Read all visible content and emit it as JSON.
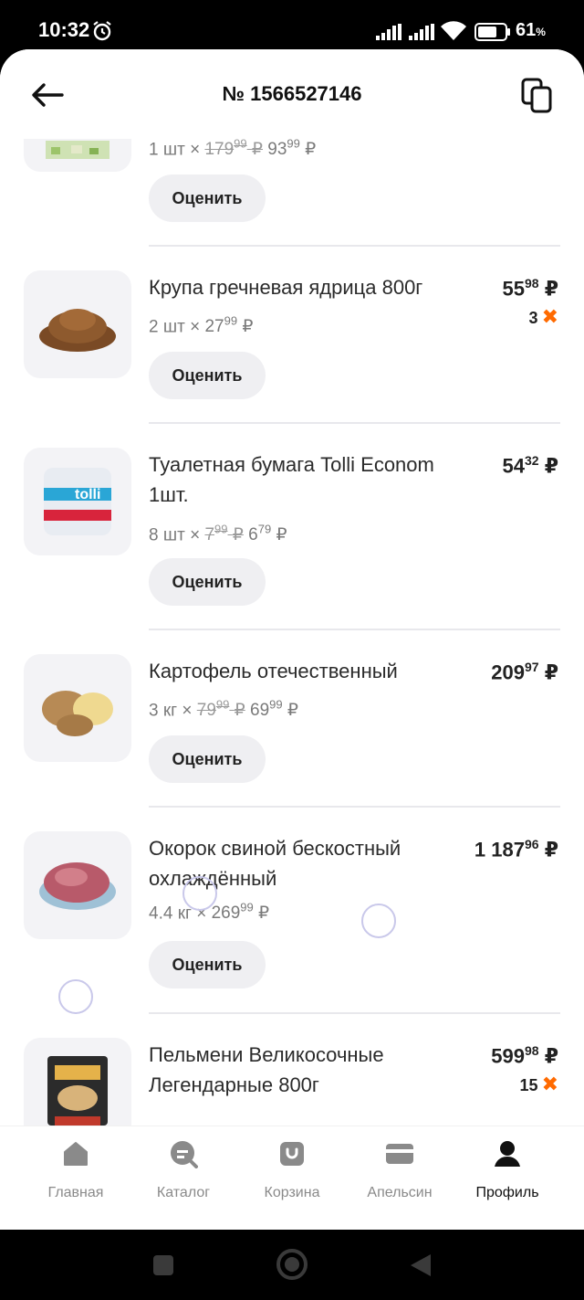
{
  "status_bar": {
    "time": "10:32",
    "battery_percent": "61",
    "battery_unit": "%"
  },
  "header": {
    "title": "№ 1566527146"
  },
  "items": [
    {
      "name": "",
      "qty_prefix": "1 шт ×",
      "old_price_main": "179",
      "old_price_cents": "99",
      "new_price_main": "93",
      "new_price_cents": "99",
      "currency": "₽",
      "total_main": "",
      "total_cents": "",
      "bonus": "",
      "image": "product-image-salad",
      "rate_label": "Оценить"
    },
    {
      "name": "Крупа гречневая ядрица 800г",
      "qty_prefix": "2 шт ×",
      "unit_price_main": "27",
      "unit_price_cents": "99",
      "currency": "₽",
      "total_main": "55",
      "total_cents": "98",
      "bonus": "3",
      "image": "buckwheat-image",
      "rate_label": "Оценить"
    },
    {
      "name_line1": "Туалетная бумага Tolli Econom",
      "name_line2": "1шт.",
      "qty_prefix": "8 шт ×",
      "old_price_main": "7",
      "old_price_cents": "99",
      "new_price_main": "6",
      "new_price_cents": "79",
      "currency": "₽",
      "total_main": "54",
      "total_cents": "32",
      "image": "toilet-paper-image",
      "rate_label": "Оценить"
    },
    {
      "name": "Картофель отечественный",
      "qty_prefix": "3 кг ×",
      "old_price_main": "79",
      "old_price_cents": "99",
      "new_price_main": "69",
      "new_price_cents": "99",
      "currency": "₽",
      "total_main": "209",
      "total_cents": "97",
      "image": "potato-image",
      "rate_label": "Оценить"
    },
    {
      "name_line1": "Окорок свиной бескостный",
      "name_line2": "охлаждённый",
      "qty_prefix": "4.4 кг ×",
      "unit_price_main": "269",
      "unit_price_cents": "99",
      "currency": "₽",
      "total_main": "1 187",
      "total_cents": "96",
      "image": "pork-ham-image",
      "rate_label": "Оценить"
    },
    {
      "name_line1": "Пельмени Великосочные",
      "name_line2": "Легендарные 800г",
      "total_main": "599",
      "total_cents": "98",
      "currency": "₽",
      "bonus": "15",
      "image": "dumplings-pack-image"
    }
  ],
  "bonus_icon": "x-cross-icon",
  "accent_color": "#ff6a00",
  "nav": [
    {
      "label": "Главная",
      "icon": "home-icon"
    },
    {
      "label": "Каталог",
      "icon": "catalog-search-icon"
    },
    {
      "label": "Корзина",
      "icon": "cart-bag-icon"
    },
    {
      "label": "Апельсин",
      "icon": "card-icon"
    },
    {
      "label": "Профиль",
      "icon": "profile-icon",
      "active": true
    }
  ]
}
